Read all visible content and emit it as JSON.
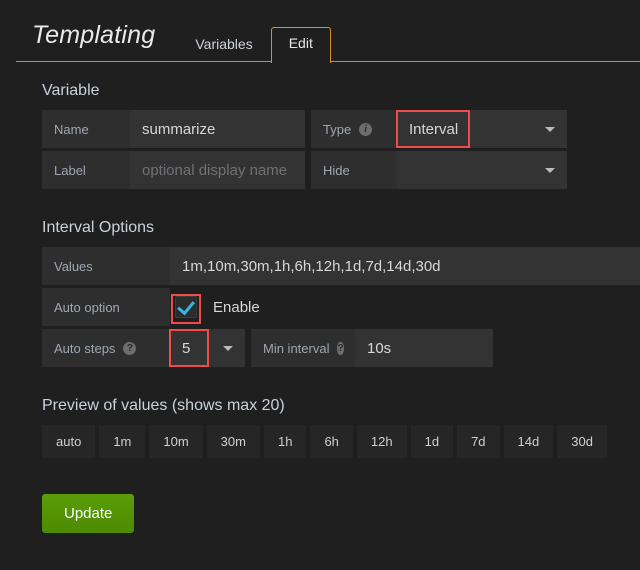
{
  "header": {
    "title": "Templating",
    "tabs": [
      {
        "label": "Variables",
        "active": false
      },
      {
        "label": "Edit",
        "active": true
      }
    ]
  },
  "variable_section": {
    "heading": "Variable",
    "name_label": "Name",
    "name_value": "summarize",
    "label_label": "Label",
    "label_placeholder": "optional display name",
    "type_label": "Type",
    "type_value": "Interval",
    "type_info_icon": "info-icon",
    "hide_label": "Hide",
    "hide_value": ""
  },
  "interval_options": {
    "heading": "Interval Options",
    "values_label": "Values",
    "values_value": "1m,10m,30m,1h,6h,12h,1d,7d,14d,30d",
    "auto_option_label": "Auto option",
    "enable_label": "Enable",
    "enable_checked": true,
    "auto_steps_label": "Auto steps",
    "auto_steps_help_icon": "help-icon",
    "auto_steps_value": "5",
    "min_interval_label": "Min interval",
    "min_interval_help_icon": "help-icon",
    "min_interval_value": "10s"
  },
  "preview": {
    "heading": "Preview of values (shows max 20)",
    "chips": [
      "auto",
      "1m",
      "10m",
      "30m",
      "1h",
      "6h",
      "12h",
      "1d",
      "7d",
      "14d",
      "30d"
    ]
  },
  "footer": {
    "update_label": "Update"
  },
  "colors": {
    "accent": "#e08c28",
    "underline": "#c8912a",
    "highlight": "#f04a4a",
    "checkmark": "#33b5e5",
    "button": "#509000",
    "page_bg": "#1f1f20",
    "label_bg": "#2e2e2e",
    "input_bg": "#333334",
    "chip_bg": "#262627"
  }
}
